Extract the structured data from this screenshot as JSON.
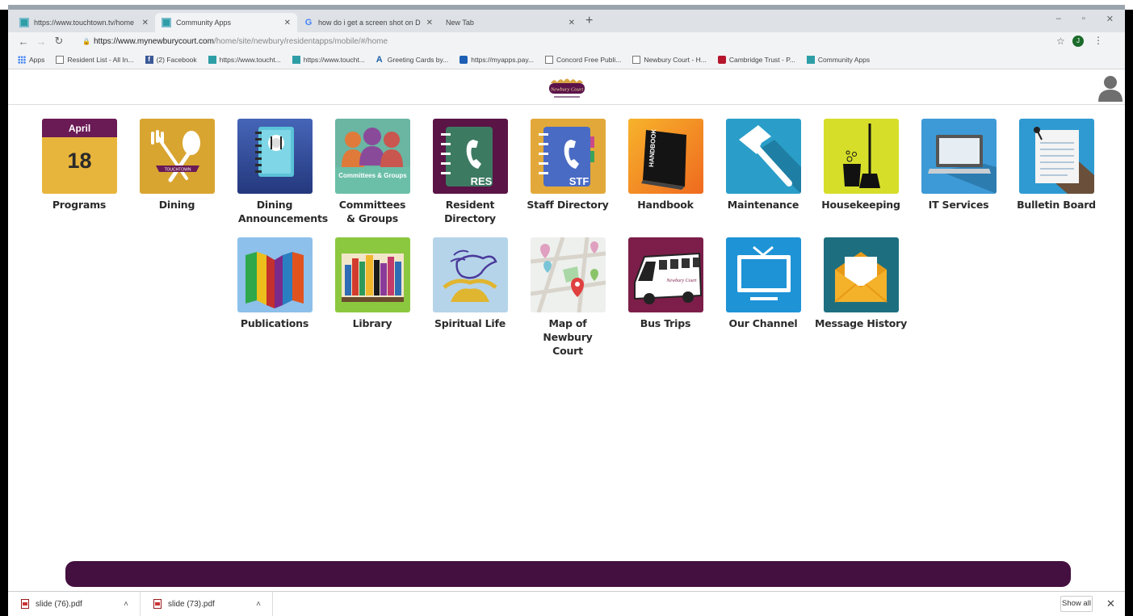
{
  "browser": {
    "tabs": [
      {
        "title": "https://www.touchtown.tv/home",
        "active": false
      },
      {
        "title": "Community Apps",
        "active": true
      },
      {
        "title": "how do i get a screen shot on D",
        "active": false
      },
      {
        "title": "New Tab",
        "active": false
      }
    ],
    "new_tab": "+",
    "window_controls": [
      "–",
      "▫",
      "✕"
    ],
    "url_host": "https://www.mynewburycourt.com",
    "url_path": "/home/site/newbury/residentapps/mobile/#/home",
    "profile_initial": "J",
    "bookmarks": [
      {
        "label": "Apps",
        "icon": "apps-grid-icon"
      },
      {
        "label": "Resident List - All In...",
        "icon": "page-icon"
      },
      {
        "label": "(2) Facebook",
        "icon": "facebook-icon"
      },
      {
        "label": "https://www.toucht...",
        "icon": "touchtown-icon"
      },
      {
        "label": "https://www.toucht...",
        "icon": "touchtown-icon"
      },
      {
        "label": "Greeting Cards by...",
        "icon": "greeting-icon"
      },
      {
        "label": "https://myapps.pay...",
        "icon": "paychex-icon"
      },
      {
        "label": "Concord Free Publi...",
        "icon": "page-icon"
      },
      {
        "label": "Newbury Court - H...",
        "icon": "page-icon"
      },
      {
        "label": "Cambridge Trust - P...",
        "icon": "cambridge-icon"
      },
      {
        "label": "Community Apps",
        "icon": "touchtown-icon"
      }
    ]
  },
  "app": {
    "logo_text": "Newbury Court",
    "tiles": [
      {
        "label": "Programs",
        "icon": "calendar-icon",
        "month": "April",
        "day": "18"
      },
      {
        "label": "Dining",
        "icon": "dining-utensils-icon",
        "badge": "TOUCHTOWN"
      },
      {
        "label": "Dining Announcements",
        "icon": "menu-book-icon"
      },
      {
        "label": "Committees & Groups",
        "icon": "people-group-icon",
        "badge": "Committees & Groups"
      },
      {
        "label": "Resident Directory",
        "icon": "phone-book-icon",
        "badge": "RES"
      },
      {
        "label": "Staff Directory",
        "icon": "phone-book-icon",
        "badge": "STF"
      },
      {
        "label": "Handbook",
        "icon": "handbook-icon",
        "badge": "HANDBOOK"
      },
      {
        "label": "Maintenance",
        "icon": "hammer-icon"
      },
      {
        "label": "Housekeeping",
        "icon": "broom-bucket-icon"
      },
      {
        "label": "IT Services",
        "icon": "laptop-icon"
      },
      {
        "label": "Bulletin Board",
        "icon": "bulletin-icon"
      },
      {
        "label": "Publications",
        "icon": "open-book-icon"
      },
      {
        "label": "Library",
        "icon": "bookshelf-icon"
      },
      {
        "label": "Spiritual Life",
        "icon": "dove-icon"
      },
      {
        "label": "Map of Newbury Court",
        "icon": "map-icon"
      },
      {
        "label": "Bus Trips",
        "icon": "bus-icon",
        "badge": "Newbury Court"
      },
      {
        "label": "Our Channel",
        "icon": "tv-icon"
      },
      {
        "label": "Message History",
        "icon": "envelope-icon"
      }
    ]
  },
  "downloads": [
    {
      "filename": "slide (76).pdf"
    },
    {
      "filename": "slide (73).pdf"
    }
  ],
  "show_all": "Show all",
  "colors": {
    "footer_bar": "#43103f",
    "brand_purple": "#5b1349"
  }
}
